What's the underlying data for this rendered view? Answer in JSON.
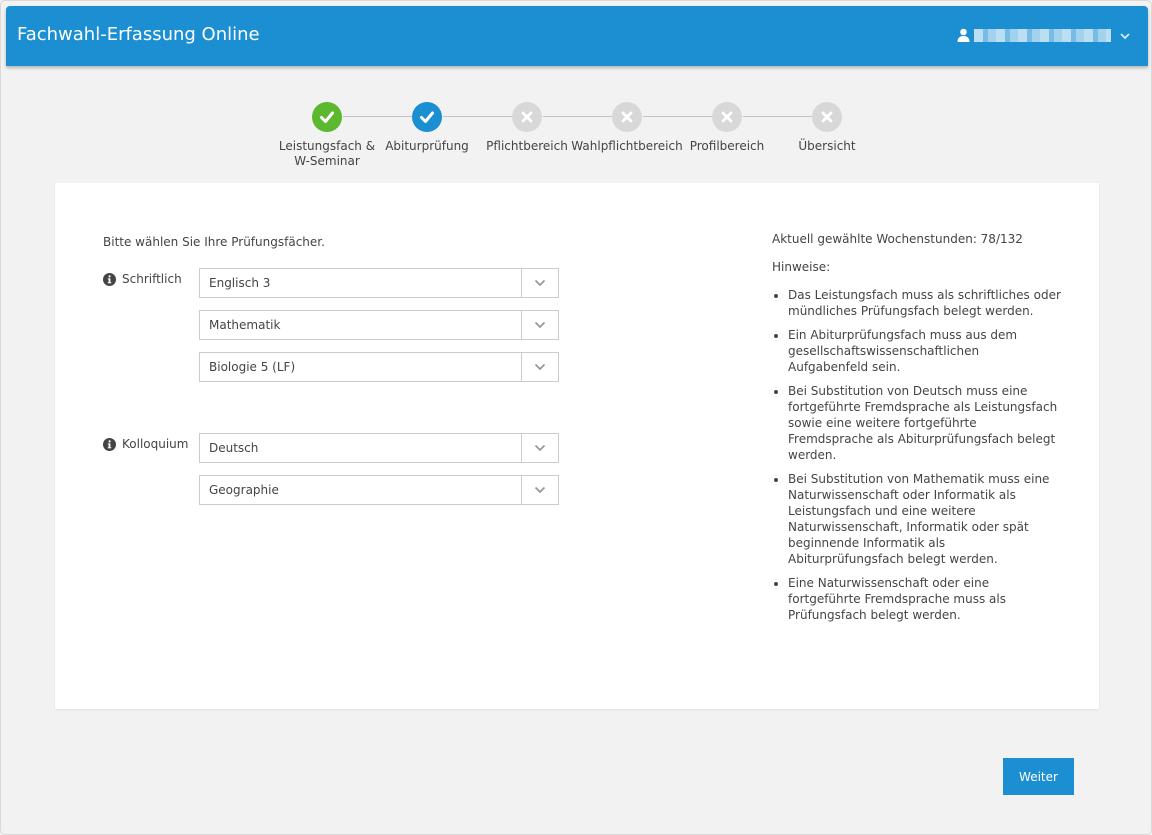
{
  "header": {
    "title": "Fachwahl-Erfassung Online",
    "user_name": "████████████",
    "user_icon": "user-icon",
    "menu_icon": "chevron-down-icon"
  },
  "colors": {
    "brand": "#1b8fd2",
    "step_complete": "#5cb82e",
    "step_current": "#1b8fd2",
    "step_pending": "#d8d8d8"
  },
  "steps": [
    {
      "label": "Leistungsfach &\nW-Seminar",
      "status": "complete",
      "icon": "check-icon"
    },
    {
      "label": "Abiturprüfung",
      "status": "current",
      "icon": "check-icon"
    },
    {
      "label": "Pflichtbereich",
      "status": "pending",
      "icon": "close-icon"
    },
    {
      "label": "Wahlpflichtbereich",
      "status": "pending",
      "icon": "close-icon"
    },
    {
      "label": "Profilbereich",
      "status": "pending",
      "icon": "close-icon"
    },
    {
      "label": "Übersicht",
      "status": "pending",
      "icon": "close-icon"
    }
  ],
  "form": {
    "instruction": "Bitte wählen Sie Ihre Prüfungsfächer.",
    "groups": [
      {
        "label": "Schriftlich",
        "icon": "info-icon",
        "selects": [
          "Englisch 3",
          "Mathematik",
          "Biologie 5 (LF)"
        ]
      },
      {
        "label": "Kolloquium",
        "icon": "info-icon",
        "selects": [
          "Deutsch",
          "Geographie"
        ]
      }
    ]
  },
  "side": {
    "hours": "Aktuell gewählte Wochenstunden: 78/132",
    "hints_title": "Hinweise:",
    "hints": [
      "Das Leistungsfach muss als schriftliches oder mündliches Prüfungsfach belegt werden.",
      "Ein Abiturprüfungsfach muss aus dem gesellschaftswissenschaftlichen Aufgabenfeld sein.",
      "Bei Substitution von Deutsch muss eine fortgeführte Fremdsprache als Leistungsfach sowie eine weitere fortgeführte Fremdsprache als Abiturprüfungsfach belegt werden.",
      "Bei Substitution von Mathematik muss eine Naturwissenschaft oder Informatik als Leistungsfach und eine weitere Naturwissenschaft, Informatik oder spät beginnende Informatik als Abiturprüfungsfach belegt werden.",
      "Eine Naturwissenschaft oder eine fortgeführte Fremdsprache muss als Prüfungsfach belegt werden."
    ]
  },
  "footer": {
    "next_label": "Weiter"
  }
}
